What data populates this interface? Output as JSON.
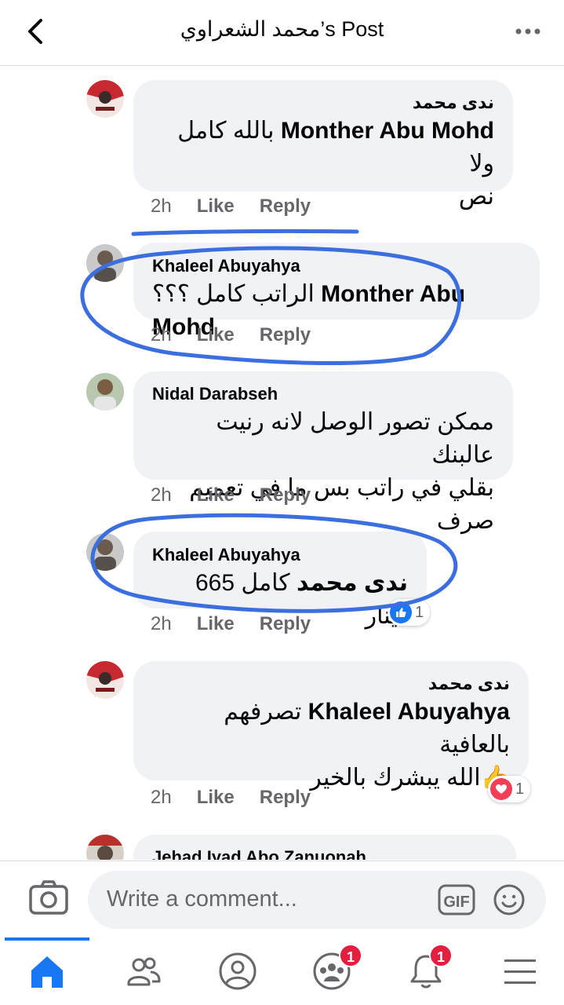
{
  "header": {
    "title": "محمد الشعراوي’s Post"
  },
  "comments": [
    {
      "name": "ندى محمد",
      "tag": "Monther Abu Mohd",
      "text_line1": "بالله كامل ولا",
      "text_line2": "نص",
      "time": "2h",
      "like": "Like",
      "reply": "Reply"
    },
    {
      "name": "Khaleel Abuyahya",
      "tag": "Monther Abu Mohd",
      "text": "الراتب كامل ؟؟؟",
      "time": "2h",
      "like": "Like",
      "reply": "Reply"
    },
    {
      "name": "Nidal Darabseh",
      "text_line1": "ممكن تصور الوصل لانه رنيت عالبنك",
      "text_line2": "بقلي في راتب بس ما في تعميم صرف",
      "time": "2h",
      "like": "Like",
      "reply": "Reply"
    },
    {
      "name": "Khaleel Abuyahya",
      "tag": "ندى محمد",
      "text": "كامل 665 دينار",
      "time": "2h",
      "like": "Like",
      "reply": "Reply",
      "reaction_count": "1",
      "reaction_icon": "like-icon"
    },
    {
      "name": "ندى محمد",
      "tag": "Khaleel Abuyahya",
      "text_line1": "تصرفهم بالعافية",
      "text_line2": "الله يبشرك بالخير",
      "time": "2h",
      "like": "Like",
      "reply": "Reply",
      "reaction_count": "1",
      "reaction_icon": "love-icon"
    },
    {
      "name": "Jehad Iyad Abo Zanuonah"
    }
  ],
  "composer": {
    "placeholder": "Write a comment..."
  },
  "tabs": [
    {
      "icon": "home-icon",
      "active": true
    },
    {
      "icon": "friends-icon"
    },
    {
      "icon": "profile-icon"
    },
    {
      "icon": "groups-icon",
      "badge": "1"
    },
    {
      "icon": "notifications-icon",
      "badge": "1"
    },
    {
      "icon": "menu-icon"
    }
  ],
  "colors": {
    "accent": "#1877f2",
    "annotation": "#3b6fe0",
    "badge": "#e41e3f",
    "bubble": "#f0f2f5"
  }
}
